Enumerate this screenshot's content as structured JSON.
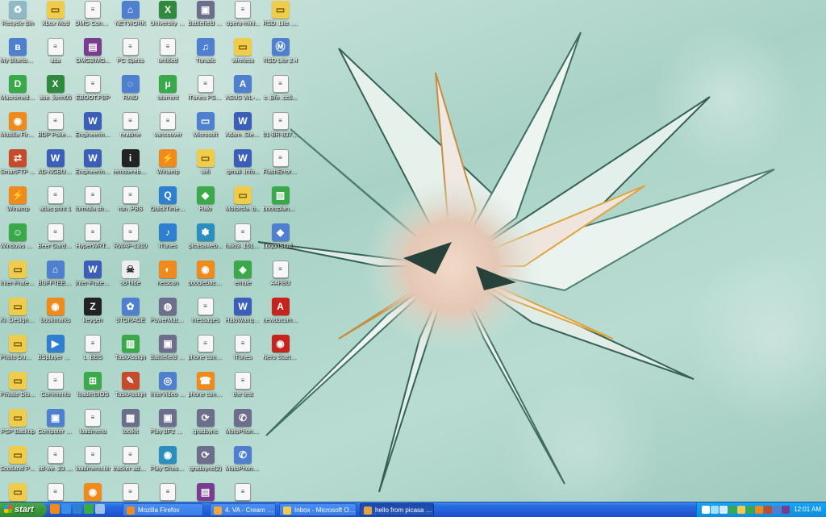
{
  "desktop": {
    "icons": [
      {
        "label": "Recycle Bin",
        "icon": "recycle-bin-icon",
        "kind": "bin",
        "glyph": "♻"
      },
      {
        "label": "My Bluetooth Places",
        "icon": "bluetooth-icon",
        "kind": "net",
        "glyph": "ʙ"
      },
      {
        "label": "Macromedia Dreamwea...",
        "icon": "dreamweaver-icon",
        "kind": "green",
        "glyph": "D"
      },
      {
        "label": "Mozilla Firefox 2 Beta 1",
        "icon": "firefox-icon",
        "kind": "orange",
        "glyph": "◉"
      },
      {
        "label": "SmartFTP Client",
        "icon": "smartftp-icon",
        "kind": "app",
        "glyph": "⇄"
      },
      {
        "label": "Winamp",
        "icon": "winamp-icon",
        "kind": "orange",
        "glyph": "⚡"
      },
      {
        "label": "Windows Live Messenger",
        "icon": "messenger-icon",
        "kind": "green",
        "glyph": "☺"
      },
      {
        "label": "Inter-Frater... Council at U...",
        "icon": "folder-icon",
        "kind": "folder",
        "glyph": "▭"
      },
      {
        "label": "KI_Design Studio Test...",
        "icon": "folder-icon",
        "kind": "folder",
        "glyph": "▭"
      },
      {
        "label": "Photo Dump File",
        "icon": "folder-icon",
        "kind": "folder",
        "glyph": "▭"
      },
      {
        "label": "Private Disk Multifactor",
        "icon": "folder-icon",
        "kind": "folder",
        "glyph": "▭"
      },
      {
        "label": "PSP Backup",
        "icon": "folder-icon",
        "kind": "folder",
        "glyph": "▭"
      },
      {
        "label": "Scotland Photos",
        "icon": "folder-icon",
        "kind": "folder",
        "glyph": "▭"
      },
      {
        "label": "",
        "icon": "folder-icon",
        "kind": "folder",
        "glyph": "▭"
      },
      {
        "label": "Xbox Mod",
        "icon": "folder-icon",
        "kind": "folder",
        "glyph": "▭"
      },
      {
        "label": "asa",
        "icon": "document-icon",
        "kind": "doc",
        "glyph": "≡"
      },
      {
        "label": "ase_form05",
        "icon": "excel-icon",
        "kind": "xls",
        "glyph": "X"
      },
      {
        "label": "BDP Poker Table",
        "icon": "document-icon",
        "kind": "doc",
        "glyph": "≡"
      },
      {
        "label": "AD-NGBULE...",
        "icon": "word-icon",
        "kind": "word",
        "glyph": "W"
      },
      {
        "label": "atlas print 1",
        "icon": "document-icon",
        "kind": "doc",
        "glyph": "≡"
      },
      {
        "label": "Beer Garden Poster",
        "icon": "document-icon",
        "kind": "doc",
        "glyph": "≡"
      },
      {
        "label": "BUFFTEEF5...",
        "icon": "network-icon",
        "kind": "net",
        "glyph": "⌂"
      },
      {
        "label": "bookmarks",
        "icon": "firefox-icon",
        "kind": "orange",
        "glyph": "◉"
      },
      {
        "label": "BSplayer Pro",
        "icon": "media-player-icon",
        "kind": "media",
        "glyph": "▶"
      },
      {
        "label": "Comments",
        "icon": "document-icon",
        "kind": "doc",
        "glyph": "≡"
      },
      {
        "label": "Computer Managem...",
        "icon": "computer-icon",
        "kind": "net",
        "glyph": "▣"
      },
      {
        "label": "sd-we_23_...",
        "icon": "document-icon",
        "kind": "doc",
        "glyph": "≡"
      },
      {
        "label": "",
        "icon": "document-icon",
        "kind": "doc",
        "glyph": "≡"
      },
      {
        "label": "DMG Converter Settings.txt",
        "icon": "text-file-icon",
        "kind": "doc",
        "glyph": "≡"
      },
      {
        "label": "DMG2IMG...",
        "icon": "archive-icon",
        "kind": "rar",
        "glyph": "▤"
      },
      {
        "label": "EBOOT.PBP",
        "icon": "document-icon",
        "kind": "doc",
        "glyph": "≡"
      },
      {
        "label": "Engineering Admissio...",
        "icon": "word-icon",
        "kind": "word",
        "glyph": "W"
      },
      {
        "label": "Engineering Admissio...",
        "icon": "word-icon",
        "kind": "word",
        "glyph": "W"
      },
      {
        "label": "formula sheet",
        "icon": "document-icon",
        "kind": "doc",
        "glyph": "≡"
      },
      {
        "label": "HyperWRT...",
        "icon": "document-icon",
        "kind": "doc",
        "glyph": "≡"
      },
      {
        "label": "Inter-Frater... Council of UVA",
        "icon": "word-icon",
        "kind": "word",
        "glyph": "W"
      },
      {
        "label": "keygen",
        "icon": "keygen-icon",
        "kind": "dark",
        "glyph": "Z"
      },
      {
        "label": "L_BBS",
        "icon": "document-icon",
        "kind": "doc",
        "glyph": "≡"
      },
      {
        "label": "loaderBIOS",
        "icon": "windows-icon",
        "kind": "green",
        "glyph": "⊞"
      },
      {
        "label": "loadmenu",
        "icon": "document-icon",
        "kind": "doc",
        "glyph": "≡"
      },
      {
        "label": "loadmenu.txt",
        "icon": "document-icon",
        "kind": "doc",
        "glyph": "≡"
      },
      {
        "label": "",
        "icon": "firefox-icon",
        "kind": "orange",
        "glyph": "◉"
      },
      {
        "label": "NETWORK",
        "icon": "network-icon",
        "kind": "net",
        "glyph": "⌂"
      },
      {
        "label": "PC Specs",
        "icon": "document-icon",
        "kind": "doc",
        "glyph": "≡"
      },
      {
        "label": "RAID",
        "icon": "drive-icon",
        "kind": "net",
        "glyph": "◌"
      },
      {
        "label": "readme",
        "icon": "document-icon",
        "kind": "doc",
        "glyph": "≡"
      },
      {
        "label": "remotereboot",
        "icon": "info-icon",
        "kind": "dark",
        "glyph": "i"
      },
      {
        "label": "run_PBS",
        "icon": "document-icon",
        "kind": "doc",
        "glyph": "≡"
      },
      {
        "label": "RWAP-1310",
        "icon": "document-icon",
        "kind": "doc",
        "glyph": "≡"
      },
      {
        "label": "sd-hide",
        "icon": "skull-icon",
        "kind": "skull",
        "glyph": "☠"
      },
      {
        "label": "STORAGE",
        "icon": "gear-icon",
        "kind": "net",
        "glyph": "✿"
      },
      {
        "label": "TaskAssign",
        "icon": "task-icon",
        "kind": "green",
        "glyph": "▥"
      },
      {
        "label": "TaskAssign",
        "icon": "task-icon",
        "kind": "app",
        "glyph": "✎"
      },
      {
        "label": "toolkit",
        "icon": "toolkit-icon",
        "kind": "exe",
        "glyph": "▦"
      },
      {
        "label": "tracker adm.fix",
        "icon": "document-icon",
        "kind": "doc",
        "glyph": "≡"
      },
      {
        "label": "",
        "icon": "document-icon",
        "kind": "doc",
        "glyph": "≡"
      },
      {
        "label": "University Budget",
        "icon": "excel-icon",
        "kind": "xls",
        "glyph": "X"
      },
      {
        "label": "untitled",
        "icon": "document-icon",
        "kind": "doc",
        "glyph": "≡"
      },
      {
        "label": "utorrent",
        "icon": "utorrent-icon",
        "kind": "green",
        "glyph": "µ"
      },
      {
        "label": "vancouver",
        "icon": "document-icon",
        "kind": "doc",
        "glyph": "≡"
      },
      {
        "label": "Winamp",
        "icon": "winamp-icon",
        "kind": "orange",
        "glyph": "⚡"
      },
      {
        "label": "QuickTime Player",
        "icon": "quicktime-icon",
        "kind": "media",
        "glyph": "Q"
      },
      {
        "label": "iTunes",
        "icon": "music-icon",
        "kind": "media",
        "glyph": "♪"
      },
      {
        "label": "netscan",
        "icon": "app-icon",
        "kind": "orange",
        "glyph": "◐"
      },
      {
        "label": "PowerMate 1.3.0",
        "icon": "powermate-icon",
        "kind": "exe",
        "glyph": "◍"
      },
      {
        "label": "Battlefield 2142",
        "icon": "battlefield-icon",
        "kind": "exe",
        "glyph": "▣"
      },
      {
        "label": "InterVideo WinDVD...",
        "icon": "dvd-icon",
        "kind": "net",
        "glyph": "◎"
      },
      {
        "label": "Play BF2 2142 Online Now!",
        "icon": "battlefield-icon",
        "kind": "exe",
        "glyph": "▣"
      },
      {
        "label": "Play Ghost Recon A...",
        "icon": "globe-icon",
        "kind": "globe",
        "glyph": "◉"
      },
      {
        "label": "",
        "icon": "document-icon",
        "kind": "doc",
        "glyph": "≡"
      },
      {
        "label": "Battlefield 2142 Demo",
        "icon": "battlefield-icon",
        "kind": "exe",
        "glyph": "▣"
      },
      {
        "label": "Tunatic",
        "icon": "music-icon",
        "kind": "net",
        "glyph": "♫"
      },
      {
        "label": "iTunes PSP...",
        "icon": "document-icon",
        "kind": "doc",
        "glyph": "≡"
      },
      {
        "label": "Microsoft",
        "icon": "window-icon",
        "kind": "net",
        "glyph": "▭"
      },
      {
        "label": "wifi",
        "icon": "folder-icon",
        "kind": "folder",
        "glyph": "▭"
      },
      {
        "label": "Halo",
        "icon": "halo-icon",
        "kind": "green",
        "glyph": "◆"
      },
      {
        "label": "picasaweb...",
        "icon": "picasa-icon",
        "kind": "globe",
        "glyph": "✽"
      },
      {
        "label": "googlebackup",
        "icon": "firefox-icon",
        "kind": "orange",
        "glyph": "◉"
      },
      {
        "label": "messages",
        "icon": "document-icon",
        "kind": "doc",
        "glyph": "≡"
      },
      {
        "label": "phone contacts",
        "icon": "book-icon",
        "kind": "doc",
        "glyph": "≡"
      },
      {
        "label": "phone contacts",
        "icon": "contacts-icon",
        "kind": "orange",
        "glyph": "☎"
      },
      {
        "label": "gradsync",
        "icon": "sync-icon",
        "kind": "exe",
        "glyph": "⟳"
      },
      {
        "label": "gradsync(2)",
        "icon": "sync-icon",
        "kind": "exe",
        "glyph": "⟳"
      },
      {
        "label": "",
        "icon": "archive-icon",
        "kind": "rar",
        "glyph": "▤"
      },
      {
        "label": "opera-mini...",
        "icon": "document-icon",
        "kind": "doc",
        "glyph": "≡"
      },
      {
        "label": "wireless",
        "icon": "folder-icon",
        "kind": "folder",
        "glyph": "▭"
      },
      {
        "label": "ASUS WL-HP solo",
        "icon": "asus-icon",
        "kind": "net",
        "glyph": "A"
      },
      {
        "label": "Adam_Stern...",
        "icon": "word-icon",
        "kind": "word",
        "glyph": "W"
      },
      {
        "label": "gmail_info...",
        "icon": "word-icon",
        "kind": "word",
        "glyph": "W"
      },
      {
        "label": "Motorola_b...",
        "icon": "folder-icon",
        "kind": "folder",
        "glyph": "▭"
      },
      {
        "label": "halo3_1512...",
        "icon": "document-icon",
        "kind": "doc",
        "glyph": "≡"
      },
      {
        "label": "emule",
        "icon": "emule-icon",
        "kind": "green",
        "glyph": "◈"
      },
      {
        "label": "HaloWang2...",
        "icon": "word-icon",
        "kind": "word",
        "glyph": "W"
      },
      {
        "label": "iTunes",
        "icon": "document-icon",
        "kind": "doc",
        "glyph": "≡"
      },
      {
        "label": "the test",
        "icon": "document-icon",
        "kind": "doc",
        "glyph": "≡"
      },
      {
        "label": "MotoPhone...",
        "icon": "phone-icon",
        "kind": "exe",
        "glyph": "✆"
      },
      {
        "label": "MotoPhone...",
        "icon": "phone-icon",
        "kind": "net",
        "glyph": "✆"
      },
      {
        "label": "",
        "icon": "document-icon",
        "kind": "doc",
        "glyph": "≡"
      },
      {
        "label": "RSD_Lite_2...",
        "icon": "folder-icon",
        "kind": "folder",
        "glyph": "▭"
      },
      {
        "label": "RSD Lite 2.4",
        "icon": "motorola-icon",
        "kind": "net",
        "glyph": "Ⓜ"
      },
      {
        "label": "c_Bfe_cc5...",
        "icon": "document-icon",
        "kind": "doc",
        "glyph": "≡"
      },
      {
        "label": "01-BR-8374...",
        "icon": "document-icon",
        "kind": "doc",
        "glyph": "≡"
      },
      {
        "label": "FlashError.log1",
        "icon": "document-icon",
        "kind": "doc",
        "glyph": "≡"
      },
      {
        "label": "bootsplan_file",
        "icon": "image-icon",
        "kind": "green",
        "glyph": "▧"
      },
      {
        "label": "LogonStudio...",
        "icon": "logonstudio-icon",
        "kind": "net",
        "glyph": "◆"
      },
      {
        "label": "A4H8U",
        "icon": "document-icon",
        "kind": "doc",
        "glyph": "≡"
      },
      {
        "label": "newdocument",
        "icon": "pdf-icon",
        "kind": "pdf",
        "glyph": "A"
      },
      {
        "label": "Nero StartSmart",
        "icon": "nero-icon",
        "kind": "pdf",
        "glyph": "◉"
      }
    ]
  },
  "taskbar": {
    "start_label": "start",
    "quick_launch": [
      {
        "icon": "firefox-icon",
        "color": "#f08a1c"
      },
      {
        "icon": "ie-icon",
        "color": "#3a8ee8"
      },
      {
        "icon": "media-player-icon",
        "color": "#2f7fd0"
      },
      {
        "icon": "messenger-icon",
        "color": "#3aa94a"
      },
      {
        "icon": "show-desktop-icon",
        "color": "#9fc0e8"
      }
    ],
    "tasks": [
      {
        "label": "Mozilla Firefox",
        "icon": "firefox-icon",
        "color": "#f08a1c",
        "active": false
      },
      {
        "label": "4. VA - Cream Summe...",
        "icon": "winamp-icon",
        "color": "#f3a83a",
        "active": false
      },
      {
        "label": "Inbox - Microsoft Out...",
        "icon": "outlook-icon",
        "color": "#f0cc4c",
        "active": false
      },
      {
        "label": "hello from picasa (ad...",
        "icon": "picasa-icon",
        "color": "#e8a23a",
        "active": true
      }
    ],
    "tray_icons": [
      {
        "icon": "help-icon",
        "color": "#ffffff"
      },
      {
        "icon": "network-tray-icon",
        "color": "#9fe0ff"
      },
      {
        "icon": "volume-icon",
        "color": "#d7e9ff"
      },
      {
        "icon": "messenger-tray-icon",
        "color": "#3aa94a"
      },
      {
        "icon": "antivirus-icon",
        "color": "#f0cc4c"
      },
      {
        "icon": "utorrent-tray-icon",
        "color": "#3aa94a"
      },
      {
        "icon": "security-icon",
        "color": "#f08a1c"
      },
      {
        "icon": "update-icon",
        "color": "#c64b2a"
      },
      {
        "icon": "dvd-tray-icon",
        "color": "#4f7fcf"
      },
      {
        "icon": "yahoo-icon",
        "color": "#7a3c8e"
      }
    ],
    "clock": "12:01 AM"
  }
}
